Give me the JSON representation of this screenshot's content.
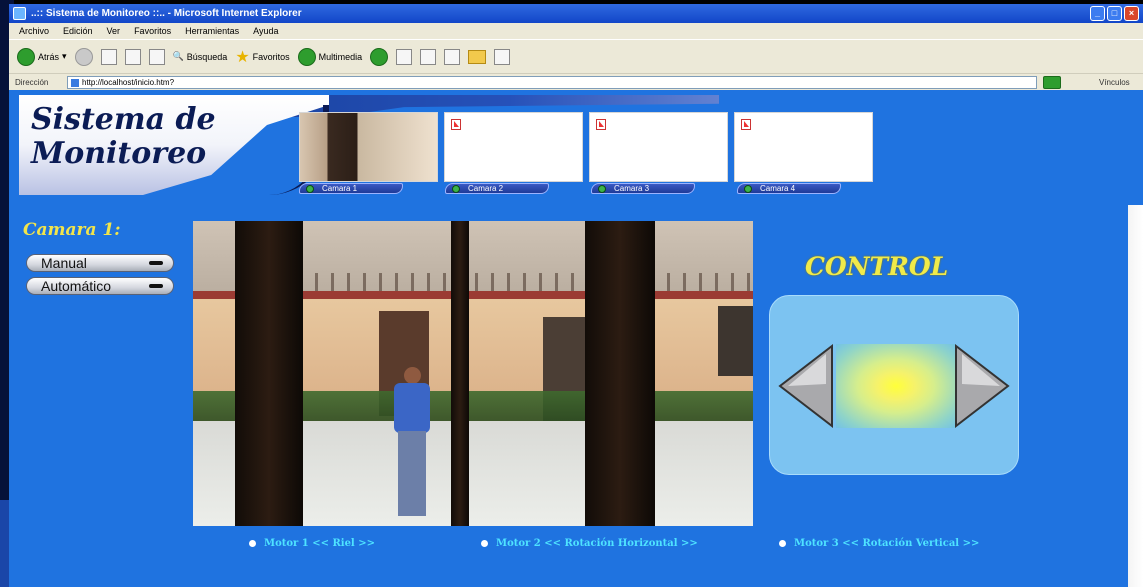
{
  "window": {
    "title": "..:: Sistema de Monitoreo ::.. - Microsoft Internet Explorer",
    "controls": [
      "_",
      "□",
      "×"
    ]
  },
  "menu": [
    "Archivo",
    "Edición",
    "Ver",
    "Favoritos",
    "Herramientas",
    "Ayuda"
  ],
  "toolbar": {
    "back": "Atrás",
    "search": "Búsqueda",
    "favorites": "Favoritos",
    "multimedia": "Multimedia"
  },
  "address": {
    "label": "Dirección",
    "url": "http://localhost/inicio.htm?",
    "links": "Vínculos"
  },
  "header": {
    "logo_line1": "Sistema de",
    "logo_line2": "Monitoreo"
  },
  "camera_tabs": [
    "Camara 1",
    "Camara 2",
    "Camara 3",
    "Camara 4"
  ],
  "sidebar": {
    "heading": "Camara 1:",
    "manual_label": "Manual",
    "auto_label": "Automático"
  },
  "control": {
    "title": "CONTROL"
  },
  "motors": [
    "Motor 1 << Riel >>",
    "Motor 2 << Rotación Horizontal >>",
    "Motor 3 << Rotación Vertical >>"
  ],
  "colors": {
    "page_bg": "#1f73e0",
    "heading_yellow": "#f2e54b",
    "motor_cyan": "#4ee3ff",
    "panel_blue": "#7cc3f1"
  }
}
